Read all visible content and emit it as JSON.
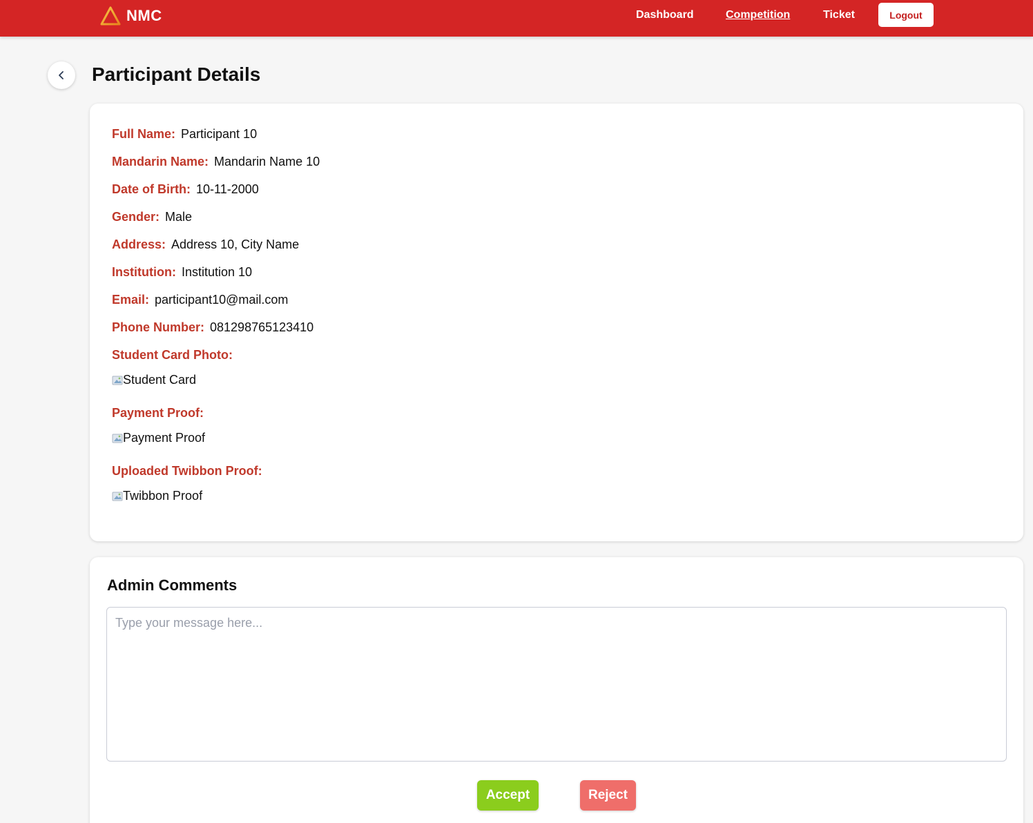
{
  "navbar": {
    "brand": "NMC",
    "links": [
      "Dashboard",
      "Competition",
      "Ticket"
    ],
    "active": "Competition",
    "logout_label": "Logout",
    "bg_color": "#d42525"
  },
  "page": {
    "title": "Participant Details"
  },
  "details": {
    "fields": [
      {
        "label": "Full Name:",
        "value": "Participant 10"
      },
      {
        "label": "Mandarin Name:",
        "value": "Mandarin Name 10"
      },
      {
        "label": "Date of Birth:",
        "value": "10-11-2000"
      },
      {
        "label": "Gender:",
        "value": "Male"
      },
      {
        "label": "Address:",
        "value": "Address 10, City Name"
      },
      {
        "label": "Institution:",
        "value": "Institution 10"
      },
      {
        "label": "Email:",
        "value": "participant10@mail.com"
      },
      {
        "label": "Phone Number:",
        "value": "081298765123410"
      }
    ],
    "images": [
      {
        "label": "Student Card Photo:",
        "alt": "Student Card"
      },
      {
        "label": "Payment Proof:",
        "alt": "Payment Proof"
      },
      {
        "label": "Uploaded Twibbon Proof:",
        "alt": "Twibbon Proof"
      }
    ],
    "label_color": "#c0392b"
  },
  "comments": {
    "title": "Admin Comments",
    "placeholder": "Type your message here...",
    "value": "",
    "accept_label": "Accept",
    "reject_label": "Reject",
    "accept_color": "#8bcd1d",
    "reject_color": "#ef6e6a"
  }
}
